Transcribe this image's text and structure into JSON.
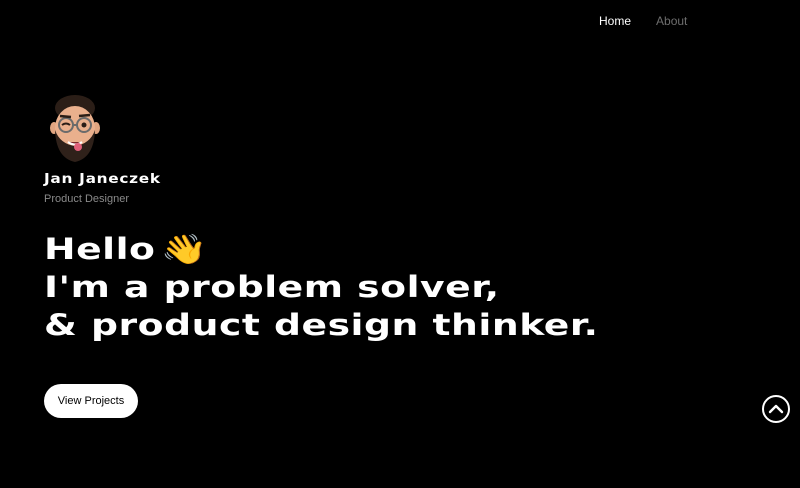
{
  "nav": {
    "items": [
      {
        "label": "Home",
        "active": true
      },
      {
        "label": "About",
        "active": false
      }
    ]
  },
  "profile": {
    "name": "Jan Janeczek",
    "role": "Product Designer",
    "avatar_icon": "memoji-avatar"
  },
  "hero": {
    "line1": "Hello",
    "wave_emoji": "👋",
    "line2": "I'm a problem solver,",
    "line3": "& product design thinker."
  },
  "cta": {
    "label": "View Projects"
  },
  "scroll_top": {
    "icon": "chevron-up-icon"
  },
  "colors": {
    "background": "#000000",
    "text": "#ffffff",
    "muted": "#8a8a8a",
    "nav_inactive": "#6e6e6e"
  }
}
